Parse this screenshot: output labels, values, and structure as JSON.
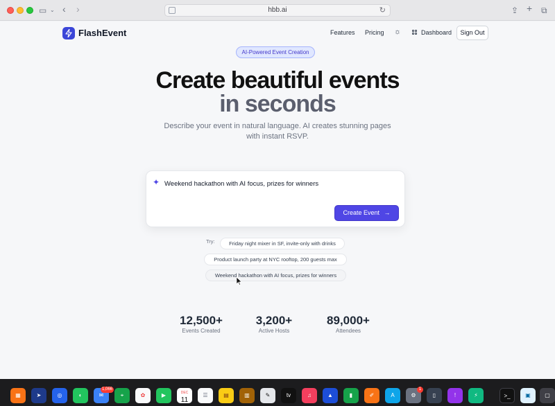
{
  "browser": {
    "url": "hbb.ai"
  },
  "nav": {
    "brand": "FlashEvent",
    "links": [
      "Features",
      "Pricing"
    ],
    "dashboard": "Dashboard",
    "signout": "Sign Out"
  },
  "hero": {
    "badge": "AI-Powered Event Creation",
    "title_line1": "Create beautiful events",
    "title_line2": "in seconds",
    "subtitle_line1": "Describe your event in natural language. AI creates stunning pages",
    "subtitle_line2": "with instant RSVP."
  },
  "prompt": {
    "value": "Weekend hackathon with AI focus, prizes for winners",
    "button": "Create Event"
  },
  "suggestions": {
    "label": "Try:",
    "items": [
      "Friday night mixer in SF, invite-only with drinks",
      "Product launch party at NYC rooftop, 200 guests max",
      "Weekend hackathon with AI focus, prizes for winners"
    ]
  },
  "stats": [
    {
      "value": "12,500+",
      "label": "Events Created"
    },
    {
      "value": "3,200+",
      "label": "Active Hosts"
    },
    {
      "value": "89,000+",
      "label": "Attendees"
    }
  ],
  "dock": {
    "mail_badge": "1,066",
    "calendar_month": "DEC",
    "calendar_day": "11",
    "settings_badge": "1",
    "tv_label": "tv"
  },
  "colors": {
    "brand": "#3b46d8",
    "accent": "#4f46e5",
    "badge_bg": "#e0e7ff"
  }
}
